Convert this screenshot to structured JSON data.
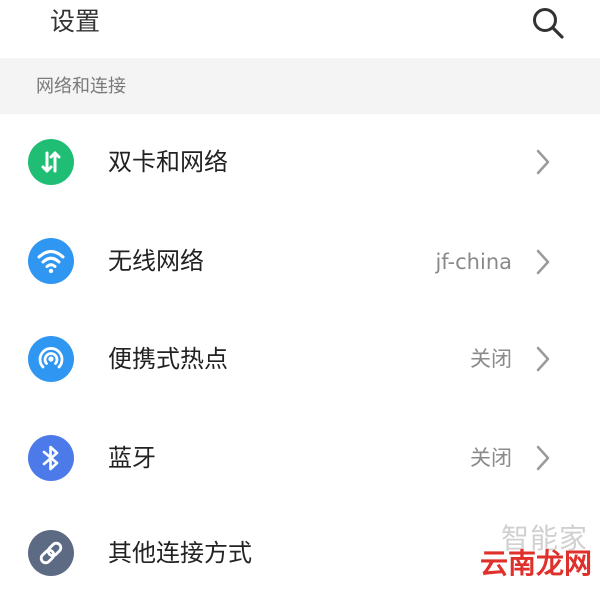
{
  "header": {
    "title": "设置",
    "search_icon": "search-icon"
  },
  "section": {
    "title": "网络和连接"
  },
  "items": [
    {
      "label": "双卡和网络",
      "value": "",
      "icon": "dual-sim-icon",
      "icon_color": "#1fbe74"
    },
    {
      "label": "无线网络",
      "value": "jf-china",
      "icon": "wifi-icon",
      "icon_color": "#2f96f1"
    },
    {
      "label": "便携式热点",
      "value": "关闭",
      "icon": "hotspot-icon",
      "icon_color": "#2f96f1"
    },
    {
      "label": "蓝牙",
      "value": "关闭",
      "icon": "bluetooth-icon",
      "icon_color": "#4c7be9"
    },
    {
      "label": "其他连接方式",
      "value": "",
      "icon": "link-icon",
      "icon_color": "#5d6a84"
    }
  ],
  "watermark": {
    "top": "智能家",
    "bottom": "云南龙网"
  }
}
